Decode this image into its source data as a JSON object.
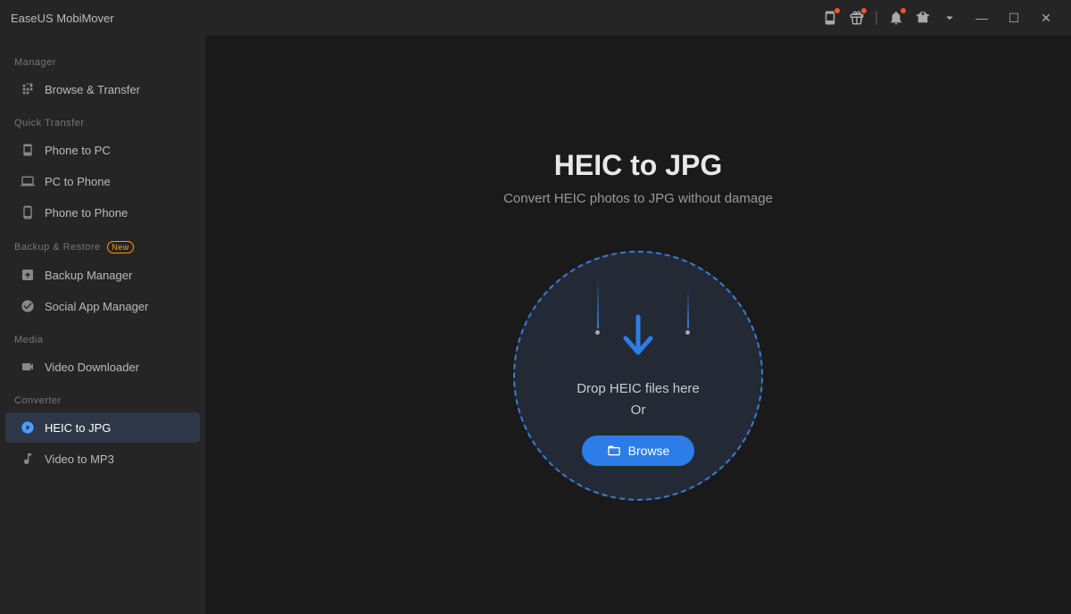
{
  "app": {
    "title": "EaseUS MobiMover",
    "colors": {
      "accent": "#2d7de8",
      "active_bg": "#2d3748",
      "sidebar_bg": "#252525",
      "content_bg": "#1a1a1a"
    }
  },
  "titlebar": {
    "title": "EaseUS MobiMover",
    "icons": [
      {
        "name": "mobile-icon",
        "has_badge": true
      },
      {
        "name": "gift-icon",
        "has_badge": true
      },
      {
        "name": "bell-icon",
        "has_badge": true
      },
      {
        "name": "shirt-icon",
        "has_badge": false
      },
      {
        "name": "dropdown-icon",
        "has_badge": false
      }
    ],
    "window_controls": {
      "minimize": "—",
      "maximize": "☐",
      "close": "✕"
    }
  },
  "sidebar": {
    "sections": [
      {
        "label": "Manager",
        "items": [
          {
            "id": "browse-transfer",
            "label": "Browse & Transfer",
            "active": false
          }
        ]
      },
      {
        "label": "Quick Transfer",
        "items": [
          {
            "id": "phone-to-pc",
            "label": "Phone to PC",
            "active": false
          },
          {
            "id": "pc-to-phone",
            "label": "PC to Phone",
            "active": false
          },
          {
            "id": "phone-to-phone",
            "label": "Phone to Phone",
            "active": false
          }
        ]
      },
      {
        "label": "Backup & Restore",
        "new_badge": "New",
        "items": [
          {
            "id": "backup-manager",
            "label": "Backup Manager",
            "active": false
          },
          {
            "id": "social-app-manager",
            "label": "Social App Manager",
            "active": false
          }
        ]
      },
      {
        "label": "Media",
        "items": [
          {
            "id": "video-downloader",
            "label": "Video Downloader",
            "active": false
          }
        ]
      },
      {
        "label": "Converter",
        "items": [
          {
            "id": "heic-to-jpg",
            "label": "HEIC to JPG",
            "active": true
          },
          {
            "id": "video-to-mp3",
            "label": "Video to MP3",
            "active": false
          }
        ]
      }
    ]
  },
  "content": {
    "title": "HEIC to JPG",
    "subtitle": "Convert HEIC photos to JPG without damage",
    "dropzone": {
      "drop_text": "Drop HEIC files here",
      "or_text": "Or",
      "browse_label": "Browse"
    }
  }
}
